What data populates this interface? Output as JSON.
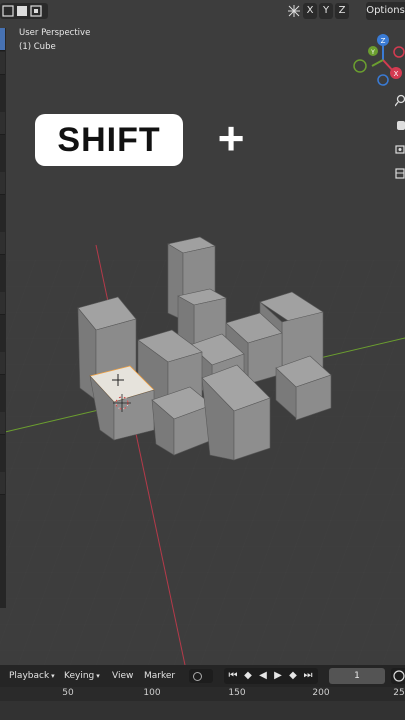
{
  "header": {
    "axis_buttons": [
      "X",
      "Y",
      "Z"
    ],
    "options_label": "Options"
  },
  "viewport": {
    "view_name": "User Perspective",
    "object_name": "(1) Cube",
    "overlay_key_label": "SHIFT",
    "overlay_plus": "+"
  },
  "gizmo": {
    "z_label": "Z",
    "y_label": "Y",
    "x_label": "X"
  },
  "colors": {
    "x_axis": "#d43b51",
    "y_axis": "#6b9e2f",
    "z_axis": "#3a7bd5",
    "background": "#3d3d3d",
    "cube_face": "#8e8e8e"
  },
  "timeline": {
    "menus": [
      "Playback",
      "Keying",
      "View",
      "Marker"
    ],
    "current_frame": "1",
    "ruler_ticks": [
      "50",
      "100",
      "150",
      "200",
      "25"
    ]
  }
}
